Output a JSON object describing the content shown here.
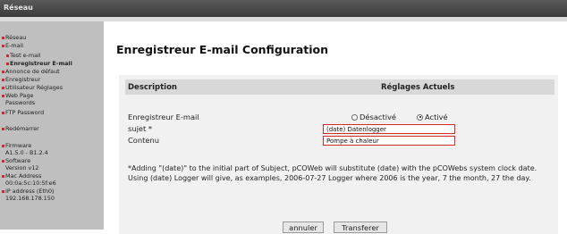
{
  "window": {
    "title": "Réseau"
  },
  "sidebar": {
    "items": [
      {
        "label": "Réseau"
      },
      {
        "label": "E-mail"
      },
      {
        "label": "Test e-mail"
      },
      {
        "label": "Enregistreur E-mail"
      },
      {
        "label": "Annonce de défaut"
      },
      {
        "label": "Enregistreur"
      },
      {
        "label": "Utilisateur Réglages"
      },
      {
        "label": "Web Page",
        "label2": "Passwords"
      },
      {
        "label": "FTP Password"
      },
      {
        "label": "Redémarrer"
      },
      {
        "label": "Firmware",
        "label2": "A1.5.0 - B1.2.4"
      },
      {
        "label": "Software",
        "label2": "Version v12"
      },
      {
        "label": "Mac Address",
        "label2": "00:0a:5c:10:5f:e6"
      },
      {
        "label": "IP address (Eth0)",
        "label2": "192.168.178.150"
      }
    ]
  },
  "main": {
    "title": "Enregistreur E-mail Configuration",
    "header": {
      "description": "Description",
      "settings": "Réglages Actuels"
    },
    "rows": {
      "logger_label": "Enregistreur E-mail",
      "subject_label": "sujet *",
      "content_label": "Contenu"
    },
    "radio": {
      "off_label": "Désactivé",
      "on_label": "Activé",
      "selected": "Activé"
    },
    "subject_value": "(date) Datenlogger",
    "content_value": "Pompe à chaleur",
    "note": "*Adding \"(date)\" to the initial part of Subject, pCOWeb will substitute (date) with the pCOWebs system clock date. Using (date) Logger will give, as examples, 2006-07-27 Logger where 2006 is the year, 7 the month, 27 the day.",
    "buttons": {
      "cancel": "annuler",
      "submit": "Transferer"
    }
  }
}
